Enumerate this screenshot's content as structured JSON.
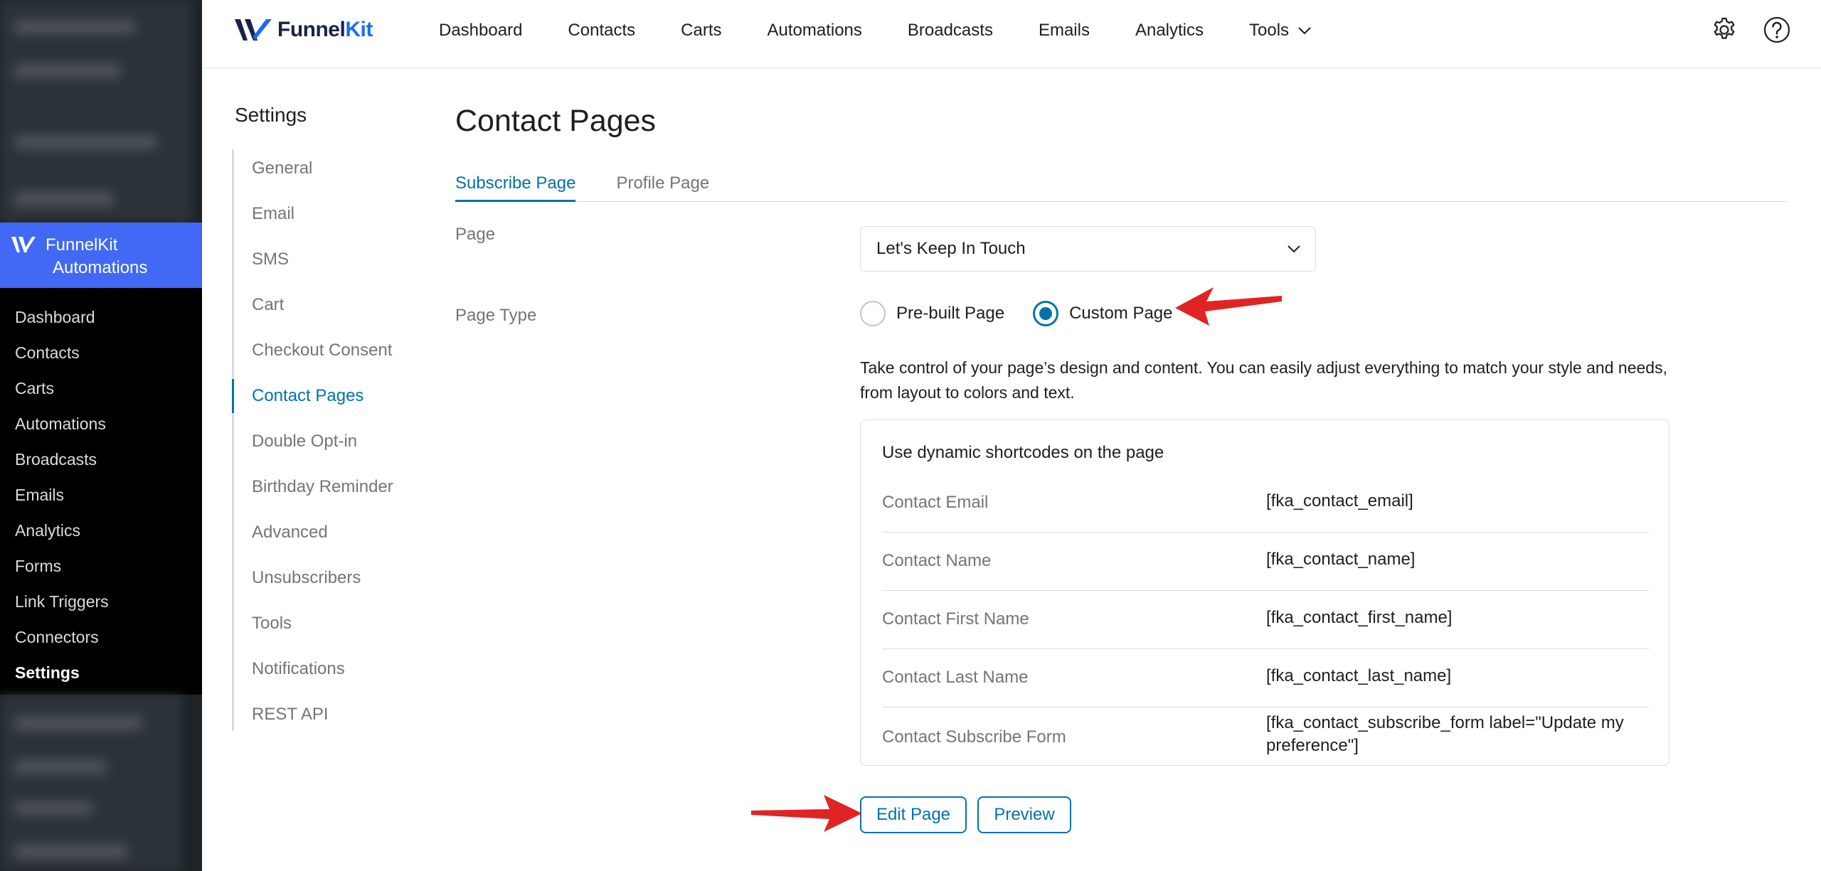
{
  "wp_sidebar": {
    "plugin_name_line1": "FunnelKit",
    "plugin_name_line2": "Automations",
    "items": [
      {
        "label": "Dashboard"
      },
      {
        "label": "Contacts"
      },
      {
        "label": "Carts"
      },
      {
        "label": "Automations"
      },
      {
        "label": "Broadcasts"
      },
      {
        "label": "Emails"
      },
      {
        "label": "Analytics"
      },
      {
        "label": "Forms"
      },
      {
        "label": "Link Triggers"
      },
      {
        "label": "Connectors"
      },
      {
        "label": "Settings"
      }
    ]
  },
  "topbar": {
    "brand_part1": "Funnel",
    "brand_part2": "Kit",
    "nav": [
      {
        "label": "Dashboard"
      },
      {
        "label": "Contacts"
      },
      {
        "label": "Carts"
      },
      {
        "label": "Automations"
      },
      {
        "label": "Broadcasts"
      },
      {
        "label": "Emails"
      },
      {
        "label": "Analytics"
      },
      {
        "label": "Tools"
      }
    ],
    "icons": [
      "gear-icon",
      "help-icon"
    ]
  },
  "settings": {
    "heading": "Settings",
    "items": [
      {
        "label": "General"
      },
      {
        "label": "Email"
      },
      {
        "label": "SMS"
      },
      {
        "label": "Cart"
      },
      {
        "label": "Checkout Consent"
      },
      {
        "label": "Contact Pages"
      },
      {
        "label": "Double Opt-in"
      },
      {
        "label": "Birthday Reminder"
      },
      {
        "label": "Advanced"
      },
      {
        "label": "Unsubscribers"
      },
      {
        "label": "Tools"
      },
      {
        "label": "Notifications"
      },
      {
        "label": "REST API"
      }
    ],
    "active": "Contact Pages"
  },
  "main": {
    "title": "Contact Pages",
    "tabs": [
      {
        "label": "Subscribe Page"
      },
      {
        "label": "Profile Page"
      }
    ],
    "page_label": "Page",
    "page_value": "Let's Keep In Touch",
    "page_type_label": "Page Type",
    "page_type_options": [
      {
        "label": "Pre-built Page"
      },
      {
        "label": "Custom Page"
      }
    ],
    "page_type_selected": "Custom Page",
    "description": "Take control of your page’s design and content. You can easily adjust everything to match your style and needs, from layout to colors and text.",
    "shortcodes_heading": "Use dynamic shortcodes on the page",
    "shortcodes": [
      {
        "label": "Contact Email",
        "code": "[fka_contact_email]"
      },
      {
        "label": "Contact Name",
        "code": "[fka_contact_name]"
      },
      {
        "label": "Contact First Name",
        "code": "[fka_contact_first_name]"
      },
      {
        "label": "Contact Last Name",
        "code": "[fka_contact_last_name]"
      },
      {
        "label": "Contact Subscribe Form",
        "code": "[fka_contact_subscribe_form label=\"Update my preference\"]"
      }
    ],
    "edit_button": "Edit Page",
    "preview_button": "Preview"
  },
  "colors": {
    "accent": "#0073aa",
    "plugin_header": "#4169f5",
    "annotation_arrow": "#e02424"
  }
}
